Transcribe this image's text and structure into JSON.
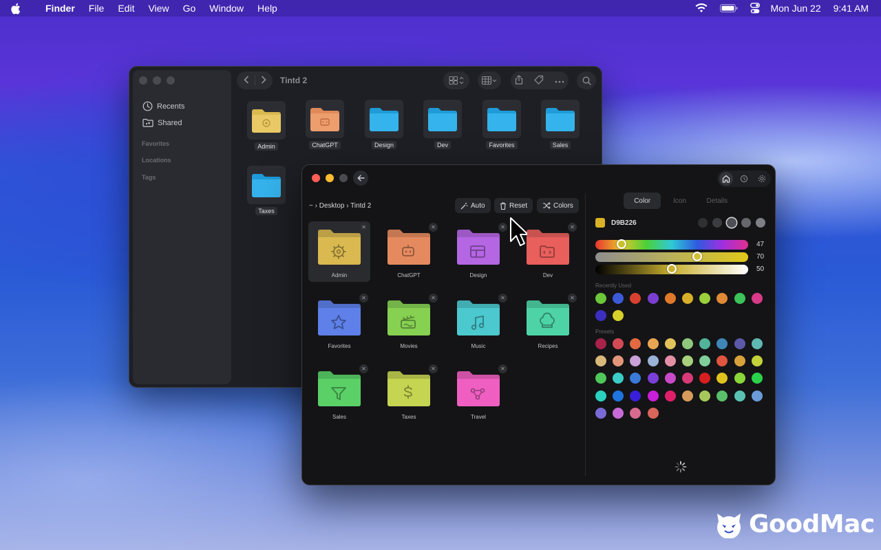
{
  "menubar": {
    "app": "Finder",
    "items": [
      "File",
      "Edit",
      "View",
      "Go",
      "Window",
      "Help"
    ],
    "date": "Mon Jun 22",
    "time": "9:41 AM",
    "icons": [
      "apple-icon",
      "wifi-icon",
      "battery-icon",
      "control-center-icon"
    ]
  },
  "finder": {
    "title": "Tintd 2",
    "sidebar": {
      "items": [
        {
          "label": "Recents",
          "icon": "clock-icon"
        },
        {
          "label": "Shared",
          "icon": "shared-folder-icon"
        }
      ],
      "sections": [
        "Favorites",
        "Locations",
        "Tags"
      ]
    },
    "folders": [
      {
        "label": "Admin",
        "color": "#D9B950",
        "glyph": "gear"
      },
      {
        "label": "ChatGPT",
        "color": "#E08A5A",
        "glyph": "robot"
      },
      {
        "label": "Design",
        "color": "#35B3EC",
        "glyph": ""
      },
      {
        "label": "Dev",
        "color": "#35B3EC",
        "glyph": ""
      },
      {
        "label": "Favorites",
        "color": "#35B3EC",
        "glyph": ""
      },
      {
        "label": "Sales",
        "color": "#35B3EC",
        "glyph": ""
      },
      {
        "label": "Taxes",
        "color": "#35B3EC",
        "glyph": ""
      }
    ]
  },
  "tintd": {
    "breadcrumb": "~ › Desktop › Tintd 2",
    "actions": [
      {
        "label": "Auto",
        "icon": "magic-wand-icon"
      },
      {
        "label": "Reset",
        "icon": "trash-icon"
      },
      {
        "label": "Colors",
        "icon": "shuffle-icon"
      }
    ],
    "folders": [
      {
        "label": "Admin",
        "color": "#D9B950",
        "glyph": "gear",
        "selected": true
      },
      {
        "label": "ChatGPT",
        "color": "#E58A5F",
        "glyph": "robot"
      },
      {
        "label": "Design",
        "color": "#B566E3",
        "glyph": "layout"
      },
      {
        "label": "Dev",
        "color": "#E85F5C",
        "glyph": "code-folder"
      },
      {
        "label": "Favorites",
        "color": "#5E80E8",
        "glyph": "star"
      },
      {
        "label": "Movies",
        "color": "#86D052",
        "glyph": "clapper"
      },
      {
        "label": "Music",
        "color": "#4CC8CF",
        "glyph": "music-note"
      },
      {
        "label": "Recipes",
        "color": "#4ED3A6",
        "glyph": "chef-hat"
      },
      {
        "label": "Sales",
        "color": "#5AD067",
        "glyph": "funnel"
      },
      {
        "label": "Taxes",
        "color": "#C5D451",
        "glyph": "dollar"
      },
      {
        "label": "Travel",
        "color": "#EE5FC1",
        "glyph": "route"
      }
    ],
    "tabs": [
      "Color",
      "Icon",
      "Details"
    ],
    "active_tab": "Color",
    "hex": "D9B226",
    "hex_color": "#D9B226",
    "shades": [
      "#2f3034",
      "#3b3c40",
      "#4e4f54",
      "#66676c",
      "#7f8085"
    ],
    "selected_shade": 2,
    "sliders": [
      {
        "name": "hue",
        "value": "47",
        "fraction": 0.15
      },
      {
        "name": "saturation",
        "value": "70",
        "fraction": 0.68
      },
      {
        "name": "brightness",
        "value": "50",
        "fraction": 0.5
      }
    ],
    "recently_used_label": "Recently Used",
    "recently_used": [
      "#6cc73a",
      "#3c5ad8",
      "#d8412f",
      "#7a3fd0",
      "#e07a2a",
      "#d8b02a",
      "#9bd13a",
      "#e08a36",
      "#3cc25a",
      "#d83a88",
      "#3a2fc0",
      "#d6d02a"
    ],
    "presets_label": "Presets",
    "presets": [
      "#a8224a",
      "#d24a56",
      "#e36a40",
      "#e8a652",
      "#e2c25a",
      "#8fc87d",
      "#52b39b",
      "#3f87b6",
      "#5c59a8",
      "#5fb9b2",
      "#d9b97a",
      "#e3957a",
      "#c9a0d8",
      "#9ab2d6",
      "#e58fa6",
      "#a8d07c",
      "#7fcf9a",
      "#e0553d",
      "#d8a13a",
      "#c3d13a",
      "#4fc75a",
      "#3ccbc6",
      "#3a7ad8",
      "#7a3fd6",
      "#c84ac8",
      "#d83a78",
      "#d81f1f",
      "#e0c21e",
      "#8bd63a",
      "#2ad24a",
      "#2ad2bf",
      "#1f74e0",
      "#3a1fd8",
      "#c81fd8",
      "#e01f6a",
      "#d89a5a",
      "#a6c85a",
      "#5abf6a",
      "#5ac2b2",
      "#6a9ad8",
      "#7a6ad8",
      "#c86ad8",
      "#d86a8f",
      "#d8665a"
    ]
  },
  "watermark": "GoodMac"
}
